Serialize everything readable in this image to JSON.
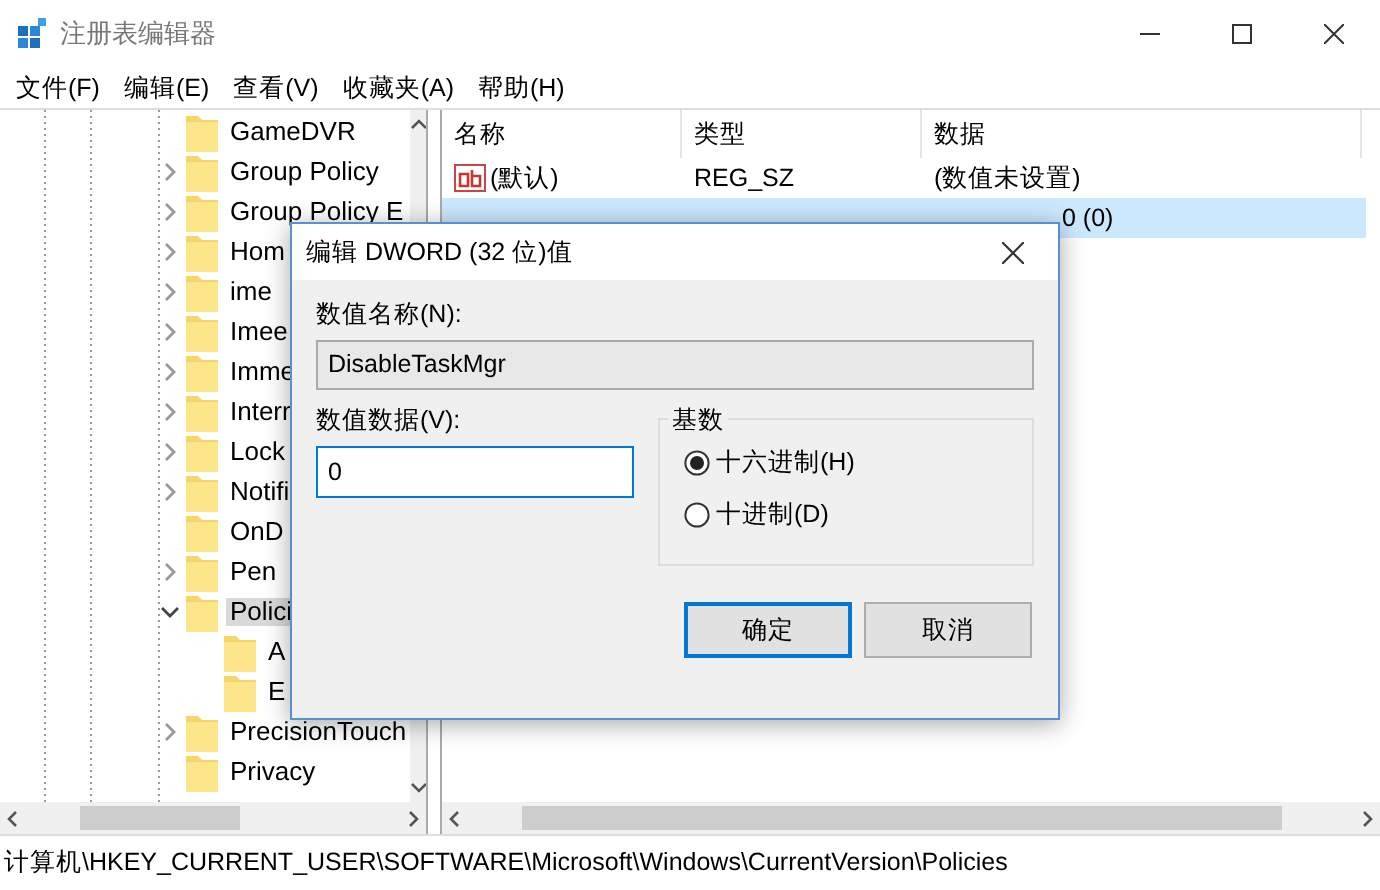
{
  "window": {
    "title": "注册表编辑器"
  },
  "menu": [
    "文件(F)",
    "编辑(E)",
    "查看(V)",
    "收藏夹(A)",
    "帮助(H)"
  ],
  "tree": {
    "items": [
      {
        "label": "GameDVR"
      },
      {
        "label": "Group Policy",
        "expanded": false
      },
      {
        "label": "Group Policy E",
        "expanded": false
      },
      {
        "label": "Hom",
        "expanded": false
      },
      {
        "label": "ime",
        "expanded": false
      },
      {
        "label": "Imee",
        "expanded": false
      },
      {
        "label": "Imme",
        "expanded": false
      },
      {
        "label": "Interr",
        "expanded": false
      },
      {
        "label": "Lock",
        "expanded": false
      },
      {
        "label": "Notifi",
        "expanded": false
      },
      {
        "label": "OnD"
      },
      {
        "label": "Pen",
        "expanded": false
      },
      {
        "label": "Polici",
        "expanded": true,
        "selected": true,
        "children": [
          {
            "label": "A"
          },
          {
            "label": "E"
          }
        ]
      },
      {
        "label": "PrecisionTouch",
        "expanded": false
      },
      {
        "label": "Privacy"
      }
    ]
  },
  "list": {
    "columns": [
      "名称",
      "类型",
      "数据"
    ],
    "rows": [
      {
        "kind": "string",
        "name": "(默认)",
        "type": "REG_SZ",
        "data": "(数值未设置)",
        "selected": false
      },
      {
        "data": "0 (0)",
        "selected": true
      }
    ]
  },
  "dialog": {
    "title": "编辑 DWORD (32 位)值",
    "name_label": "数值名称(N):",
    "name_value": "DisableTaskMgr",
    "data_label": "数值数据(V):",
    "data_value": "0",
    "base_label": "基数",
    "bases": [
      {
        "label": "十六进制(H)",
        "selected": true
      },
      {
        "label": "十进制(D)",
        "selected": false
      }
    ],
    "buttons": [
      {
        "label": "确定",
        "default": true
      },
      {
        "label": "取消",
        "default": false
      }
    ]
  },
  "status_bar": "计算机\\HKEY_CURRENT_USER\\SOFTWARE\\Microsoft\\Windows\\CurrentVersion\\Policies"
}
